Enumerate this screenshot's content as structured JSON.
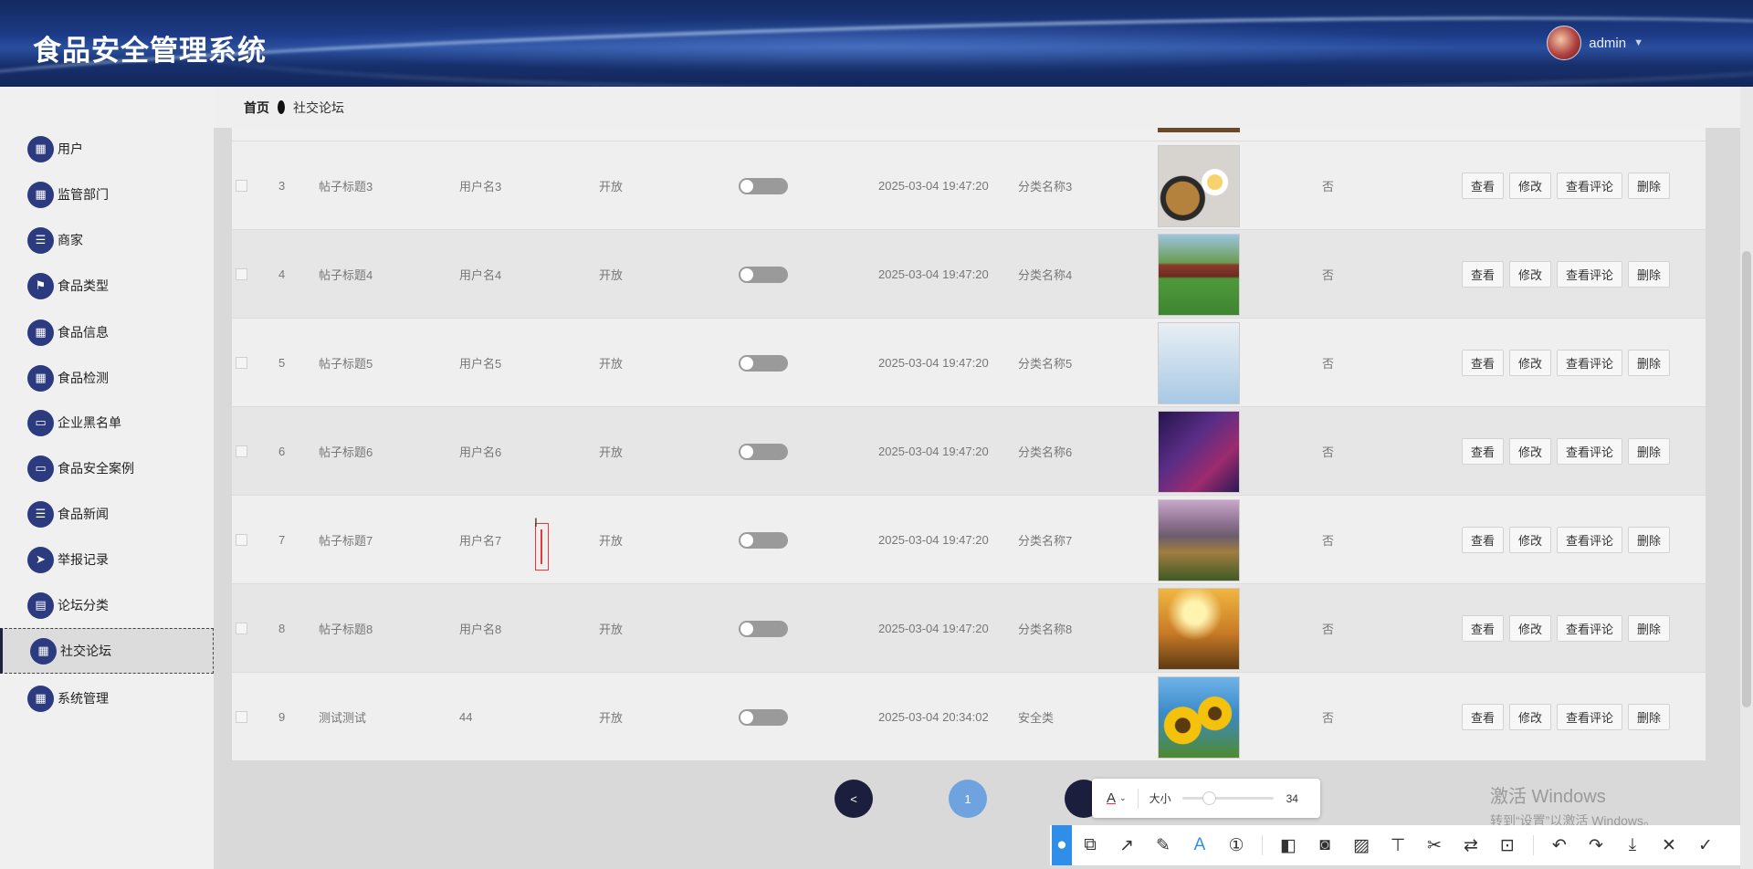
{
  "header": {
    "title": "食品安全管理系统",
    "username": "admin"
  },
  "breadcrumb": {
    "home": "首页",
    "current": "社交论坛"
  },
  "sidebar": {
    "items": [
      {
        "label": "用户",
        "icon": "grid-icon",
        "glyph": "▦"
      },
      {
        "label": "监管部门",
        "icon": "apps-icon",
        "glyph": "▦"
      },
      {
        "label": "商家",
        "icon": "list-icon",
        "glyph": "☰"
      },
      {
        "label": "食品类型",
        "icon": "flag-icon",
        "glyph": "⚑"
      },
      {
        "label": "食品信息",
        "icon": "apps-icon",
        "glyph": "▦"
      },
      {
        "label": "食品检测",
        "icon": "apps-icon",
        "glyph": "▦"
      },
      {
        "label": "企业黑名单",
        "icon": "monitor-icon",
        "glyph": "▭"
      },
      {
        "label": "食品安全案例",
        "icon": "chat-icon",
        "glyph": "▭"
      },
      {
        "label": "食品新闻",
        "icon": "menu-icon",
        "glyph": "☰"
      },
      {
        "label": "举报记录",
        "icon": "send-icon",
        "glyph": "➤"
      },
      {
        "label": "论坛分类",
        "icon": "clipboard-icon",
        "glyph": "▤"
      },
      {
        "label": "社交论坛",
        "icon": "apps-icon",
        "glyph": "▦"
      },
      {
        "label": "系统管理",
        "icon": "apps-icon",
        "glyph": "▦"
      }
    ]
  },
  "table": {
    "actions": [
      "查看",
      "修改",
      "查看评论",
      "删除"
    ],
    "rows": [
      {
        "index": "3",
        "title": "帖子标题3",
        "user": "用户名3",
        "status": "开放",
        "time": "2025-03-04 19:47:20",
        "category": "分类名称3",
        "flag": "否",
        "image": "food-photo"
      },
      {
        "index": "4",
        "title": "帖子标题4",
        "user": "用户名4",
        "status": "开放",
        "time": "2025-03-04 19:47:20",
        "category": "分类名称4",
        "flag": "否",
        "image": "campus-photo"
      },
      {
        "index": "5",
        "title": "帖子标题5",
        "user": "用户名5",
        "status": "开放",
        "time": "2025-03-04 19:47:20",
        "category": "分类名称5",
        "flag": "否",
        "image": "hockey-photo"
      },
      {
        "index": "6",
        "title": "帖子标题6",
        "user": "用户名6",
        "status": "开放",
        "time": "2025-03-04 19:47:20",
        "category": "分类名称6",
        "flag": "否",
        "image": "robots-photo"
      },
      {
        "index": "7",
        "title": "帖子标题7",
        "user": "用户名7",
        "status": "开放",
        "time": "2025-03-04 19:47:20",
        "category": "分类名称7",
        "flag": "否",
        "image": "mountain-photo"
      },
      {
        "index": "8",
        "title": "帖子标题8",
        "user": "用户名8",
        "status": "开放",
        "time": "2025-03-04 19:47:20",
        "category": "分类名称8",
        "flag": "否",
        "image": "runner-photo"
      },
      {
        "index": "9",
        "title": "测试测试",
        "user": "44",
        "status": "开放",
        "time": "2025-03-04 20:34:02",
        "category": "安全类",
        "flag": "否",
        "image": "sunflower-photo"
      }
    ]
  },
  "pagination": {
    "prev": "<",
    "current": "1"
  },
  "annotation": {
    "size_label": "大小",
    "size_value": "34",
    "font_glyph": "A"
  },
  "watermark": {
    "line1": "激活 Windows",
    "line2": "转到“设置”以激活 Windows。"
  },
  "colors": {
    "header_bg": "#1c3a86",
    "menu_icon_bg": "#2c3b80",
    "page_current": "#6fa3e0",
    "page_prev": "#1b1f3d"
  }
}
